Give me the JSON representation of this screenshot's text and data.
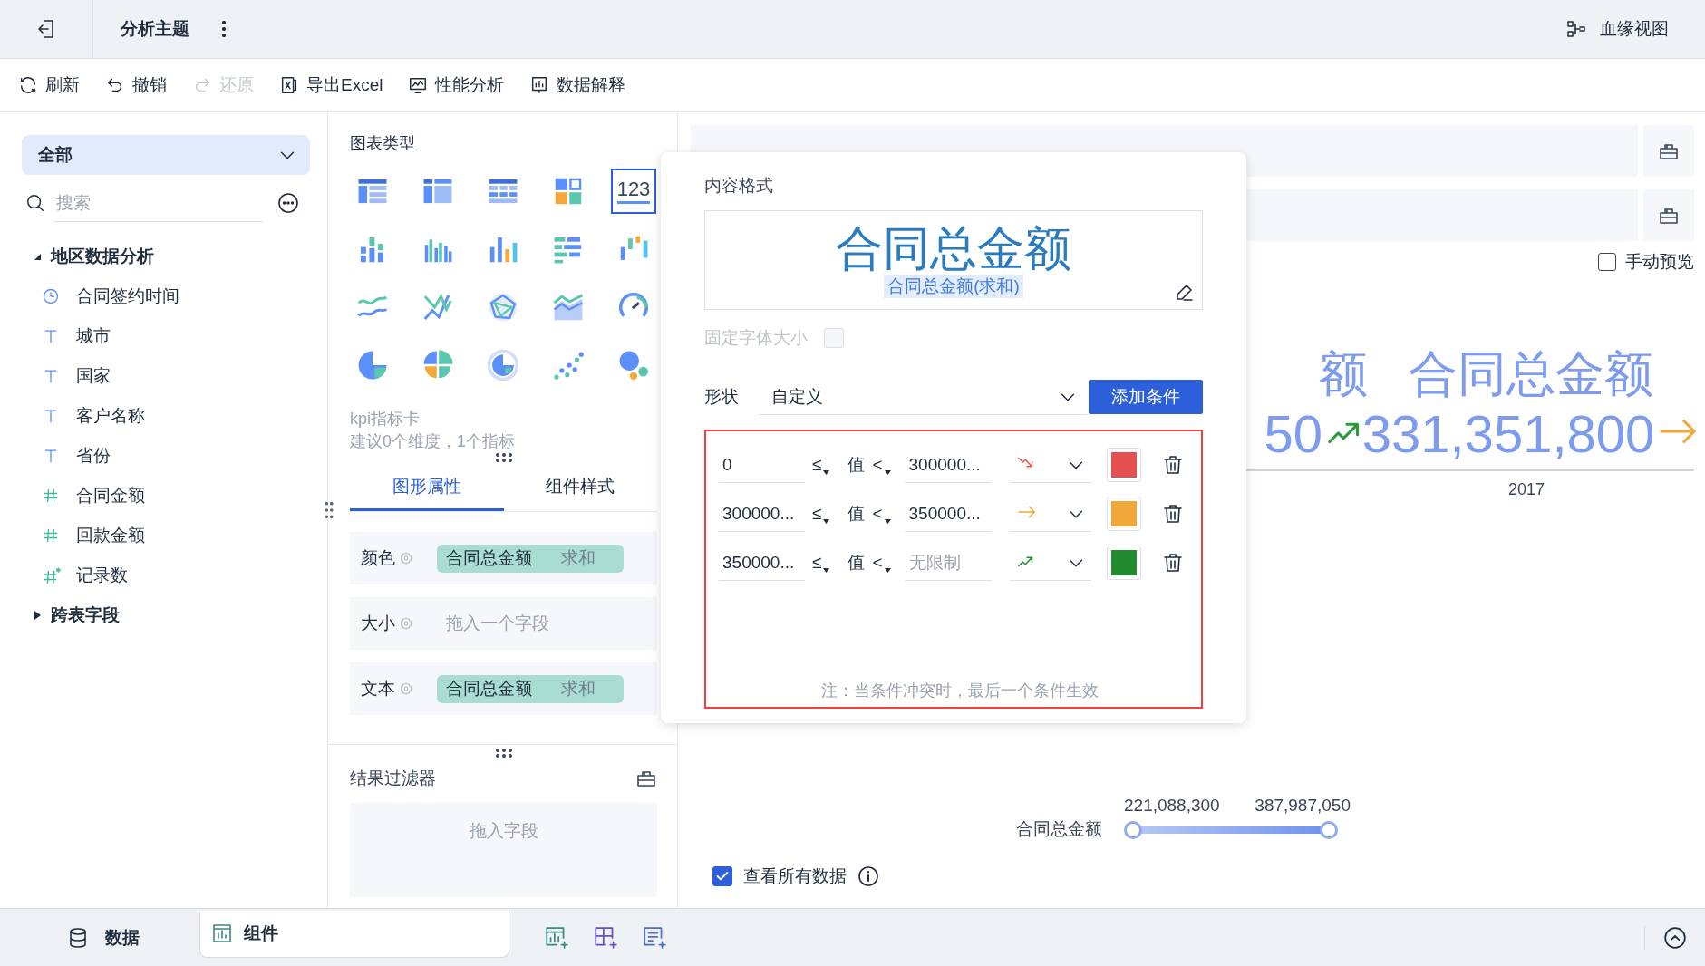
{
  "header": {
    "title": "分析主题",
    "lineage": "血缘视图"
  },
  "toolbar": [
    {
      "label": "刷新",
      "kind": "refresh",
      "disabled": false
    },
    {
      "label": "撤销",
      "kind": "undo",
      "disabled": false
    },
    {
      "label": "还原",
      "kind": "redo",
      "disabled": true
    },
    {
      "label": "导出Excel",
      "kind": "export",
      "disabled": false
    },
    {
      "label": "性能分析",
      "kind": "performance",
      "disabled": false
    },
    {
      "label": "数据解释",
      "kind": "explain",
      "disabled": false
    }
  ],
  "sidebar": {
    "dropdown": "全部",
    "search": {
      "placeholder": "搜索"
    },
    "tree": [
      {
        "label": "地区数据分析",
        "expanded": true,
        "children": [
          {
            "label": "合同签约时间",
            "kind": "date"
          },
          {
            "label": "城市",
            "kind": "text"
          },
          {
            "label": "国家",
            "kind": "text"
          },
          {
            "label": "客户名称",
            "kind": "text"
          },
          {
            "label": "省份",
            "kind": "text"
          },
          {
            "label": "合同金额",
            "kind": "number"
          },
          {
            "label": "回款金额",
            "kind": "number"
          },
          {
            "label": "记录数",
            "kind": "count"
          }
        ]
      },
      {
        "label": "跨表字段",
        "expanded": false
      }
    ]
  },
  "chart_panel": {
    "title": "图表类型",
    "chart_types": [
      {
        "kind": "table",
        "selected": false
      },
      {
        "kind": "pivot",
        "selected": false
      },
      {
        "kind": "detail",
        "selected": false
      },
      {
        "kind": "block",
        "selected": false
      },
      {
        "kind": "kpi",
        "label": "123",
        "selected": true
      },
      {
        "kind": "stacked-bar",
        "selected": false
      },
      {
        "kind": "grouped-bar",
        "selected": false
      },
      {
        "kind": "bar",
        "selected": false
      },
      {
        "kind": "hbar",
        "selected": false
      },
      {
        "kind": "waterfall",
        "selected": false
      },
      {
        "kind": "line",
        "selected": false
      },
      {
        "kind": "polyline",
        "selected": false
      },
      {
        "kind": "radar",
        "selected": false
      },
      {
        "kind": "area",
        "selected": false
      },
      {
        "kind": "gauge",
        "selected": false
      },
      {
        "kind": "pie",
        "selected": false
      },
      {
        "kind": "rose",
        "selected": false
      },
      {
        "kind": "ring",
        "selected": false
      },
      {
        "kind": "scatter",
        "selected": false
      },
      {
        "kind": "bubble",
        "selected": false
      }
    ],
    "type_name": "kpi指标卡",
    "hint": "建议0个维度，1个指标",
    "tabs": [
      {
        "label": "图形属性",
        "selected": true
      },
      {
        "label": "组件样式",
        "selected": false
      }
    ],
    "properties": [
      {
        "label": "颜色",
        "field": "合同总金额",
        "aggregation": "求和"
      },
      {
        "label": "大小",
        "placeholder": "拖入一个字段"
      },
      {
        "label": "文本",
        "field": "合同总金额",
        "aggregation": "求和"
      }
    ],
    "result_filter": {
      "title": "结果过滤器",
      "placeholder": "拖入字段"
    }
  },
  "content_format": {
    "title": "内容格式",
    "preview": {
      "title": "合同总金额",
      "field": "合同总金额(求和)"
    },
    "fixed_font_size": {
      "label": "固定字体大小",
      "checked": false,
      "disabled": true
    },
    "shape": {
      "label": "形状",
      "value": "自定义"
    },
    "add_button": "添加条件",
    "conditions": [
      {
        "min": "0",
        "op1": "≤",
        "value_label": "值",
        "op2": "<",
        "max": "300000...",
        "kind": "down",
        "color": "#e45050"
      },
      {
        "min": "300000...",
        "op1": "≤",
        "value_label": "值",
        "op2": "<",
        "max": "350000...",
        "kind": "flat",
        "color": "#f0a83a"
      },
      {
        "min": "350000...",
        "op1": "≤",
        "value_label": "值",
        "op2": "<",
        "placeholder": "无限制",
        "kind": "up",
        "color": "#228b30"
      }
    ],
    "note": "注：当条件冲突时，最后一个条件生效"
  },
  "preview": {
    "manual_preview": {
      "label": "手动预览",
      "checked": false
    },
    "kpis": [
      {
        "title": "额",
        "value": "50",
        "kind": "up",
        "color": "#2a9a3a"
      },
      {
        "title": "合同总金额",
        "value": "331,351,800",
        "kind": "flat",
        "color": "#f0a83a"
      }
    ],
    "category": "2017",
    "range_filter": {
      "label": "合同总金额",
      "min": "221,088,300",
      "max": "387,987,050",
      "thumbs": [
        {
          "level": 0
        },
        {
          "level": 1
        }
      ]
    },
    "show_all": {
      "label": "查看所有数据",
      "checked": true
    }
  },
  "bottom_tabs": [
    {
      "label": "数据",
      "kind": "data",
      "selected": false
    },
    {
      "label": "组件",
      "kind": "component",
      "selected": true
    }
  ]
}
